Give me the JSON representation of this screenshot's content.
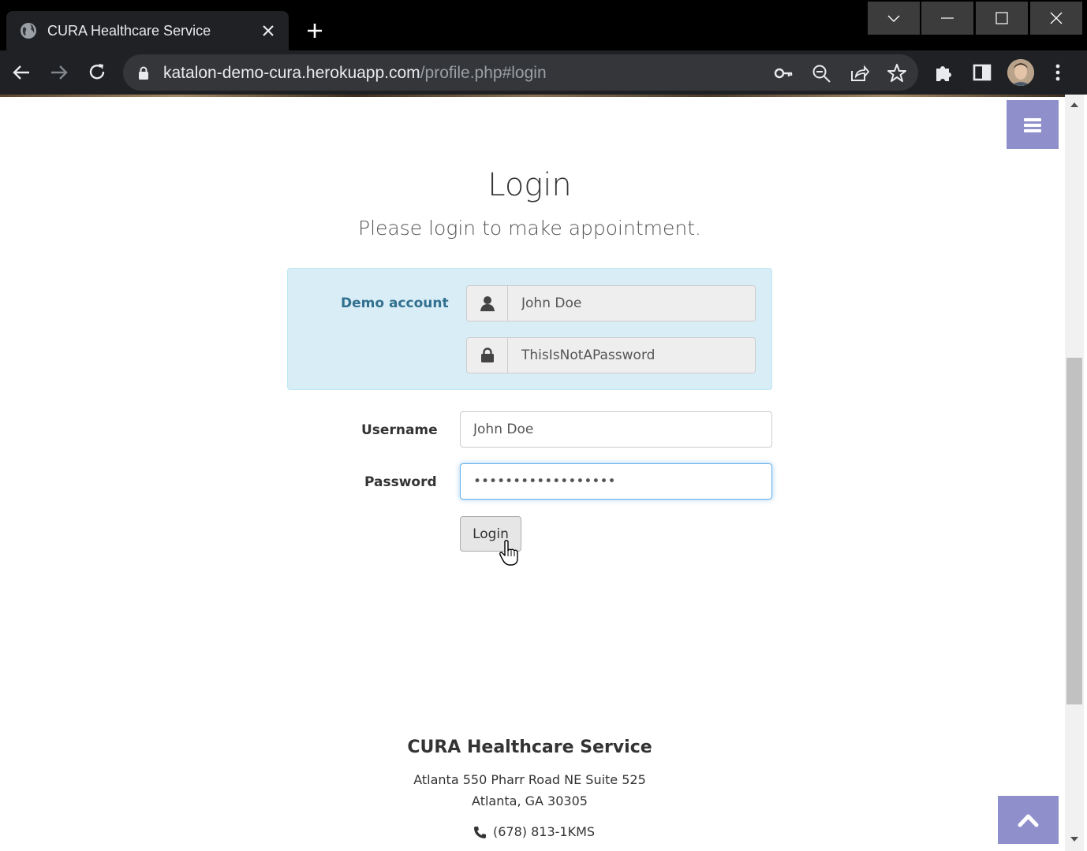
{
  "browser": {
    "tab_title": "CURA Healthcare Service",
    "url_host": "katalon-demo-cura.herokuapp.com",
    "url_path": "/profile.php#login"
  },
  "page": {
    "title": "Login",
    "subtitle": "Please login to make appointment.",
    "demo": {
      "label": "Demo account",
      "username": "John Doe",
      "password": "ThisIsNotAPassword"
    },
    "form": {
      "username_label": "Username",
      "username_value": "John Doe",
      "password_label": "Password",
      "password_value": "ThisIsNotAPassword",
      "login_button": "Login"
    },
    "footer": {
      "title": "CURA Healthcare Service",
      "address_line1": "Atlanta 550 Pharr Road NE Suite 525",
      "address_line2": "Atlanta, GA 30305",
      "phone": "(678) 813-1KMS"
    }
  },
  "colors": {
    "accent": "#8f8fcc",
    "demo_bg": "#d9edf7",
    "demo_text": "#31708f"
  }
}
